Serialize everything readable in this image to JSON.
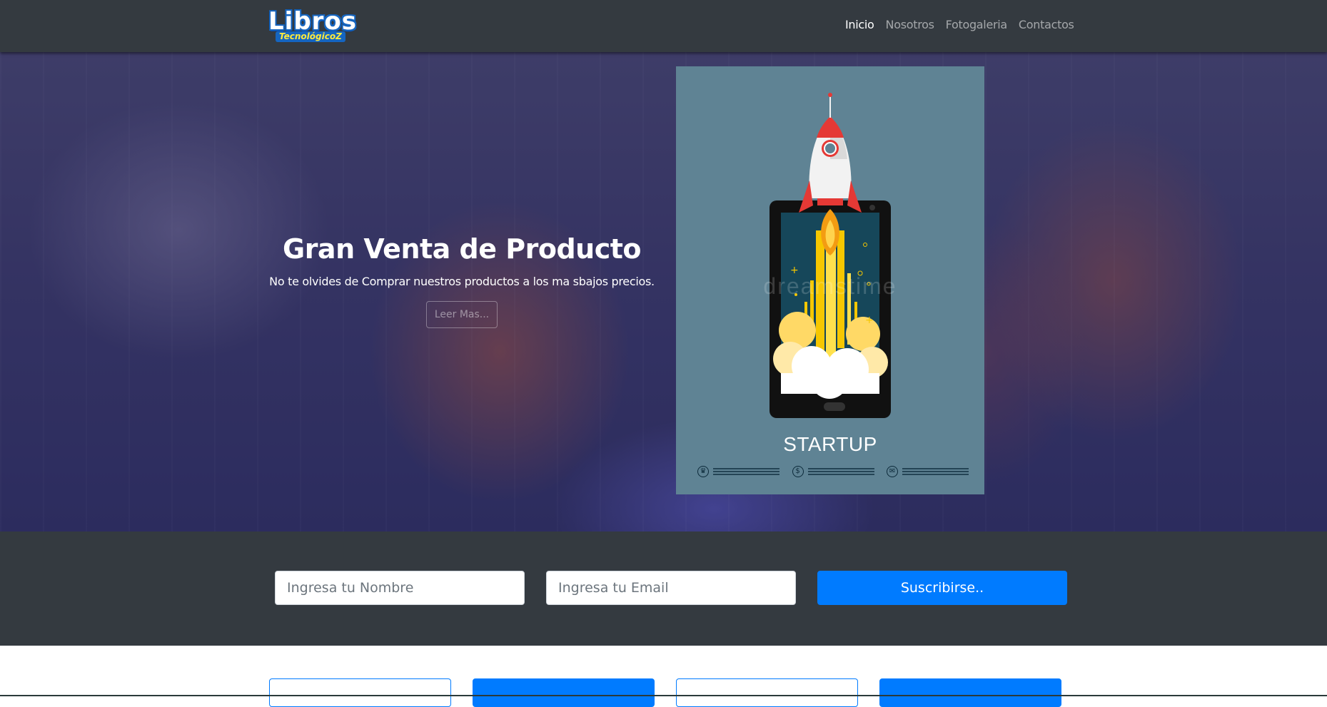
{
  "brand": {
    "logo_main": "Libros",
    "logo_sub": "TecnológicoZ"
  },
  "nav": {
    "items": [
      {
        "label": "Inicio",
        "active": true
      },
      {
        "label": "Nosotros",
        "active": false
      },
      {
        "label": "Fotogaleria",
        "active": false
      },
      {
        "label": "Contactos",
        "active": false
      }
    ]
  },
  "hero": {
    "title": "Gran Venta de Producto",
    "text": "No te olvides de Comprar nuestros productos a los ma sbajos precios.",
    "button_label": "Leer Mas..."
  },
  "poster": {
    "title": "STARTUP",
    "watermark": "dreamstime"
  },
  "subscribe": {
    "name_placeholder": "Ingresa tu Nombre",
    "email_placeholder": "Ingresa tu Email",
    "button_label": "Suscribirse.."
  },
  "colors": {
    "navbar": "#343a40",
    "primary": "#007bff",
    "poster_bg": "#5f8394"
  }
}
